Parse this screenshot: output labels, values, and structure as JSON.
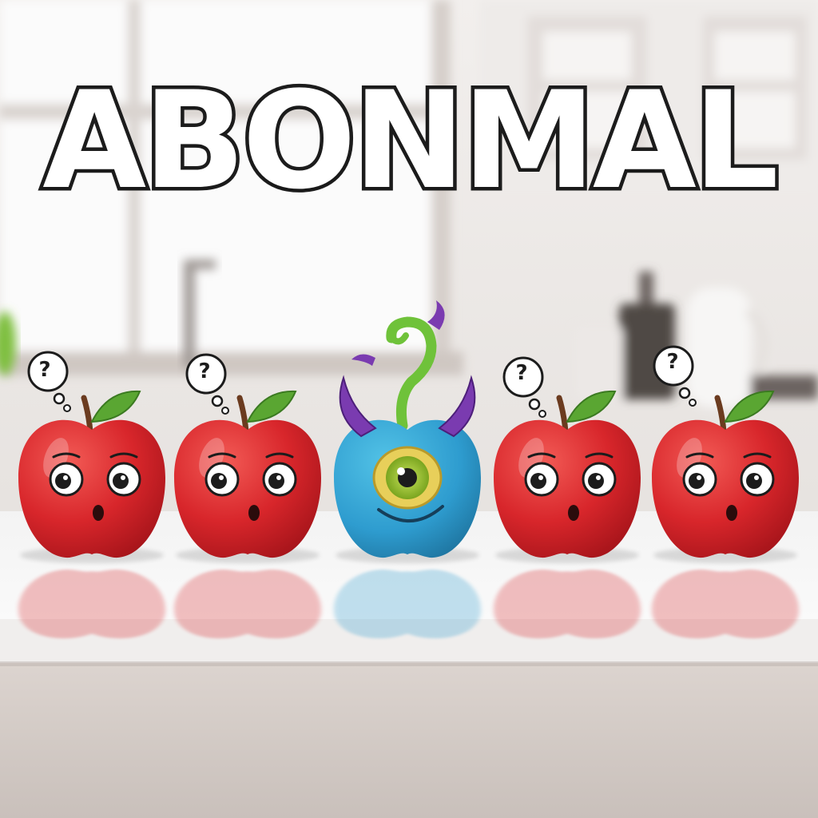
{
  "headline": {
    "text": "ABONMAL"
  },
  "thought_mark": "?",
  "scene": {
    "colors": {
      "apple_red": "#d8262b",
      "monster_blue": "#2e9ccf",
      "horn_purple": "#7a3bb0",
      "leaf_green": "#5aa632",
      "counter_white": "#f4f3f2"
    },
    "figures": [
      {
        "kind": "apple",
        "expression": "surprised",
        "thought": true
      },
      {
        "kind": "apple",
        "expression": "surprised",
        "thought": true
      },
      {
        "kind": "monster",
        "expression": "smiling-cyclops",
        "thought": false
      },
      {
        "kind": "apple",
        "expression": "surprised",
        "thought": true
      },
      {
        "kind": "apple",
        "expression": "surprised",
        "thought": true
      }
    ]
  }
}
